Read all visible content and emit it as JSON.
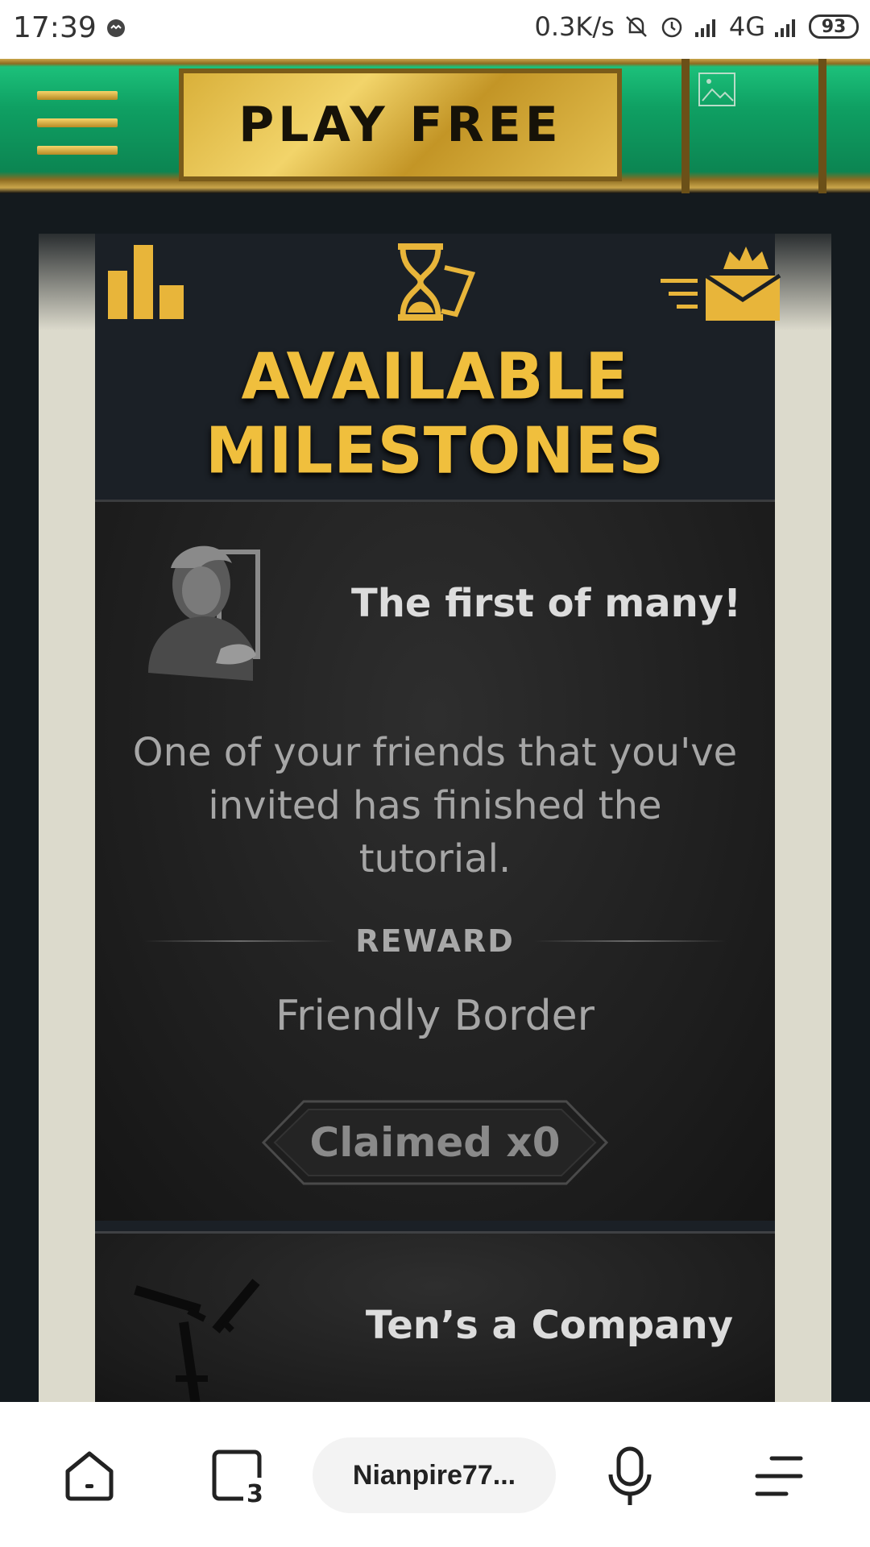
{
  "status_bar": {
    "time": "17:39",
    "net_speed": "0.3K/s",
    "network": "4G",
    "battery": "93",
    "icons": [
      "message-icon",
      "mute-bell-icon",
      "alarm-icon",
      "signal-icon",
      "signal-icon"
    ]
  },
  "top_bar": {
    "play_label": "PLAY FREE",
    "icons": [
      "menu-icon",
      "broken-image-icon"
    ]
  },
  "header": {
    "icons": [
      "leaderboard-icon",
      "hourglass-icon",
      "crown-mail-icon"
    ],
    "title": "AVAILABLE MILESTONES"
  },
  "milestones": [
    {
      "title": "The first of many!",
      "description": "One of your friends that you've invited has finished the tutorial.",
      "reward_label": "REWARD",
      "reward": "Friendly Border",
      "claimed": "Claimed x0"
    },
    {
      "title": "Ten’s a Company"
    }
  ],
  "bottom_bar": {
    "address": "Nianpire77...",
    "tab_count": "3",
    "icons": [
      "home-icon",
      "tabs-icon",
      "microphone-icon",
      "more-menu-icon"
    ]
  },
  "colors": {
    "gold": "#f0bf3d",
    "green": "#0fa063",
    "card_bg": "#1d1d1d",
    "panel_side": "#dcdacc"
  }
}
